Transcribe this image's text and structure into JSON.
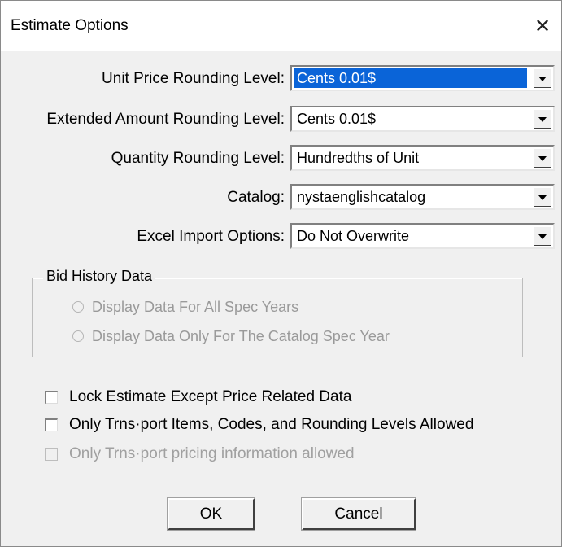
{
  "window": {
    "title": "Estimate Options",
    "close_glyph": "✕"
  },
  "fields": [
    {
      "label": "Unit Price Rounding Level:",
      "value": "Cents 0.01$",
      "highlighted": true
    },
    {
      "label": "Extended Amount Rounding Level:",
      "value": "Cents 0.01$",
      "highlighted": false
    },
    {
      "label": "Quantity Rounding Level:",
      "value": "Hundredths of Unit",
      "highlighted": false
    },
    {
      "label": "Catalog:",
      "value": "nystaenglishcatalog",
      "highlighted": false
    },
    {
      "label": "Excel Import Options:",
      "value": "Do Not Overwrite",
      "highlighted": false
    }
  ],
  "bid_history": {
    "title": "Bid History Data",
    "options": [
      {
        "label": "Display Data For All Spec Years",
        "enabled": false
      },
      {
        "label": "Display Data Only For The Catalog Spec Year",
        "enabled": false
      }
    ]
  },
  "checkboxes": [
    {
      "label": "Lock Estimate Except Price Related Data",
      "checked": false,
      "enabled": true
    },
    {
      "label": "Only Trns·port Items, Codes, and Rounding Levels Allowed",
      "checked": false,
      "enabled": true
    },
    {
      "label": "Only Trns·port pricing information allowed",
      "checked": false,
      "enabled": false
    }
  ],
  "buttons": {
    "ok": "OK",
    "cancel": "Cancel"
  },
  "colors": {
    "selection": "#0a64d8",
    "dialog_bg": "#f0f0f0"
  }
}
